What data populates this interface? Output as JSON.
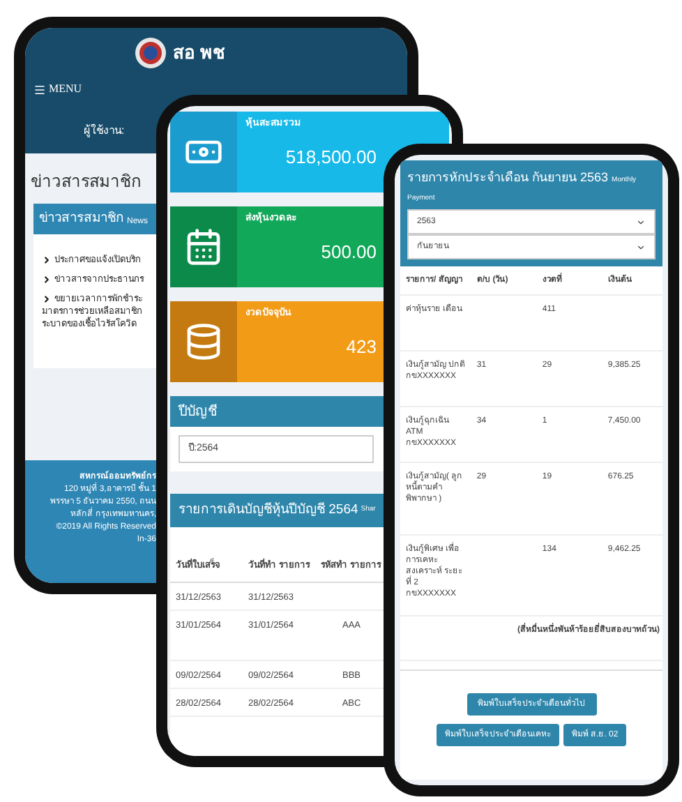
{
  "news_screen": {
    "app_name": "สอ พช",
    "menu_label": "MENU",
    "user_label": "ผู้ใช้งาน:",
    "page_title": "ข่าวสารสมาชิก",
    "news_panel": {
      "title": "ข่าวสารสมาชิก",
      "subtitle": "News",
      "items": [
        {
          "lines": [
            "ประกาศขอแจ้งเปิดบริก"
          ]
        },
        {
          "lines": [
            "ข่าวสารจากประธานกร"
          ]
        },
        {
          "lines": [
            "ขยายเวลาการพักชำระ",
            "มาตรการช่วยเหลือสมาชิก",
            "ระบาดของเชื้อไวรัสโควิด"
          ]
        }
      ]
    },
    "footer": [
      "สหกรณ์ออมทรัพย์กร",
      "120 หมู่ที่ 3,อาคารบี ชั้น 1",
      "พรรษา 5 ธันวาคม 2550, ถนน",
      "หลักสี่ กรุงเทพมหานคร,",
      "©2019 All Rights Reserved",
      "In-36"
    ]
  },
  "shares_screen": {
    "cards": [
      {
        "kind": "money",
        "label": "หุ้นสะสมรวม",
        "value": "518,500.00"
      },
      {
        "kind": "calendar",
        "label": "ส่งหุ้นงวดละ",
        "value": "500.00"
      },
      {
        "kind": "coins",
        "label": "งวดปัจจุบัน",
        "value": "423"
      }
    ],
    "year_panel": {
      "title": "ปีบัญชี",
      "select_value": "ปี:2564"
    },
    "statement": {
      "title": "รายการเดินบัญชีหุ้นปีบัญชี 2564",
      "subtitle": "Shar",
      "columns": [
        "วันที่ใบเสร็จ",
        "วันที่ทำ รายการ",
        "รหัสทำ รายการ"
      ],
      "rows": [
        [
          "31/12/2563",
          "31/12/2563",
          ""
        ],
        [
          "31/01/2564",
          "31/01/2564",
          "AAA"
        ],
        [
          "09/02/2564",
          "09/02/2564",
          "BBB"
        ],
        [
          "28/02/2564",
          "28/02/2564",
          "ABC"
        ]
      ]
    }
  },
  "payment_screen": {
    "title": "รายการหักประจำเดือน กันยายน 2563",
    "subtitle": "Monthly Payment",
    "selects": [
      "2563",
      "กันยายน"
    ],
    "columns": [
      "รายการ/ สัญญา",
      "ด/บ (วัน)",
      "งวดที่",
      "เงินต้น"
    ],
    "rows": [
      [
        "ค่าหุ้นราย เดือน",
        "",
        "411",
        ""
      ],
      [
        "เงินกู้สามัญ ปกติ กขXXXXXXX",
        "31",
        "29",
        "9,385.25"
      ],
      [
        "เงินกู้ฉุกเฉิน ATM กขXXXXXXX",
        "34",
        "1",
        "7,450.00"
      ],
      [
        "เงินกู้สามัญ( ลูกหนี้ตามคำ พิพากษา )",
        "29",
        "19",
        "676.25"
      ],
      [
        "เงินกู้พิเศษ เพื่อการเคหะ สงเคราะห์ ระยะที่ 2 กขXXXXXXX",
        "",
        "134",
        "9,462.25"
      ]
    ],
    "total_words": "(สี่หมื่นหนึ่งพันห้าร้อยยี่สิบสองบาทถ้วน)",
    "buttons": [
      "พิมพ์ใบเสร็จประจำเดือนทั่วไป",
      "พิมพ์ใบเสร็จประจำเดือนเคหะ",
      "พิมพ์ ส.ย. 02"
    ]
  }
}
